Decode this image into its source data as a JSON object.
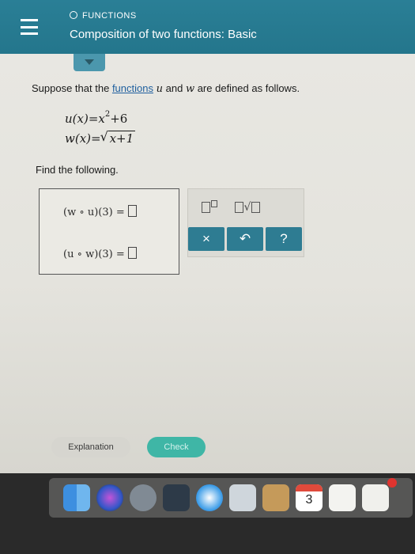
{
  "header": {
    "category": "FUNCTIONS",
    "title": "Composition of two functions: Basic"
  },
  "problem": {
    "intro_prefix": "Suppose that the",
    "intro_link": "functions",
    "var_u": "u",
    "intro_and": "and",
    "var_w": "w",
    "intro_suffix": "are defined as follows.",
    "u_def_lhs": "u(x)=x",
    "u_def_exp": "2",
    "u_def_rest": "+6",
    "w_def_lhs": "w(x)=",
    "w_def_rad": "x+1",
    "find_label": "Find the following."
  },
  "answers": {
    "row1_label": "(w ∘ u)(3) =",
    "row2_label": "(u ∘ w)(3) ="
  },
  "palette": {
    "clear_symbol": "×",
    "undo_symbol": "↶",
    "help_symbol": "?"
  },
  "footer": {
    "explanation_label": "Explanation",
    "check_label": "Check"
  },
  "dock": {
    "calendar_day": "3"
  },
  "colors": {
    "header_bg": "#2a7f96",
    "palette_button": "#2e7c92",
    "check_button": "#3fb6a6",
    "link": "#1f5f9e"
  },
  "icons": {
    "menu": "hamburger-menu-icon",
    "dropdown": "chevron-down-icon",
    "category": "ring-icon"
  }
}
